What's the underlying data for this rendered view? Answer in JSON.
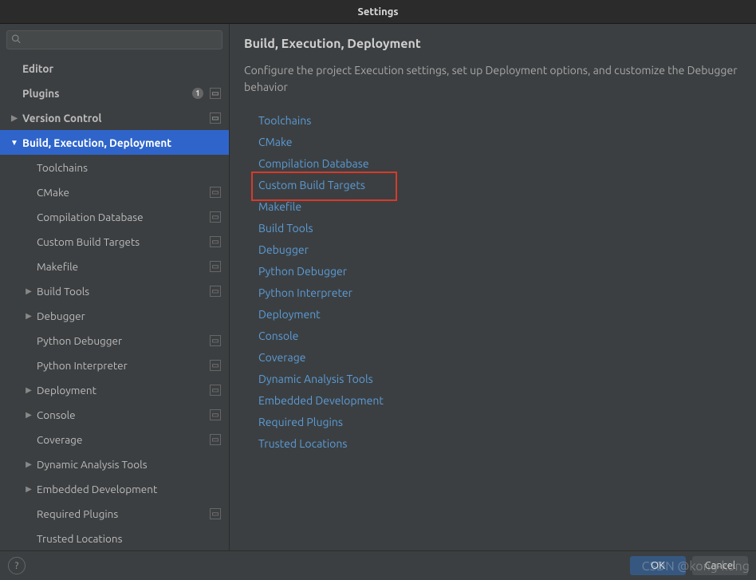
{
  "title": "Settings",
  "sidebar": {
    "search_placeholder": "",
    "items": {
      "editor": "Editor",
      "plugins": "Plugins",
      "plugins_badge": "1",
      "version_control": "Version Control",
      "bed": "Build, Execution, Deployment",
      "toolchains": "Toolchains",
      "cmake": "CMake",
      "compilation_db": "Compilation Database",
      "custom_build": "Custom Build Targets",
      "makefile": "Makefile",
      "build_tools": "Build Tools",
      "debugger": "Debugger",
      "python_debugger": "Python Debugger",
      "python_interpreter": "Python Interpreter",
      "deployment": "Deployment",
      "console": "Console",
      "coverage": "Coverage",
      "dynamic_analysis": "Dynamic Analysis Tools",
      "embedded_dev": "Embedded Development",
      "required_plugins": "Required Plugins",
      "trusted_locations": "Trusted Locations"
    }
  },
  "main": {
    "title": "Build, Execution, Deployment",
    "desc": "Configure the project Execution settings, set up Deployment options, and customize the Debugger behavior",
    "links": {
      "toolchains": "Toolchains",
      "cmake": "CMake",
      "compilation_db": "Compilation Database",
      "custom_build": "Custom Build Targets",
      "makefile": "Makefile",
      "build_tools": "Build Tools",
      "debugger": "Debugger",
      "python_debugger": "Python Debugger",
      "python_interpreter": "Python Interpreter",
      "deployment": "Deployment",
      "console": "Console",
      "coverage": "Coverage",
      "dynamic_analysis": "Dynamic Analysis Tools",
      "embedded_dev": "Embedded Development",
      "required_plugins": "Required Plugins",
      "trusted_locations": "Trusted Locations"
    }
  },
  "footer": {
    "help": "?",
    "ok": "OK",
    "cancel": "Cancel"
  },
  "watermark": "CSDN @kong-kong"
}
